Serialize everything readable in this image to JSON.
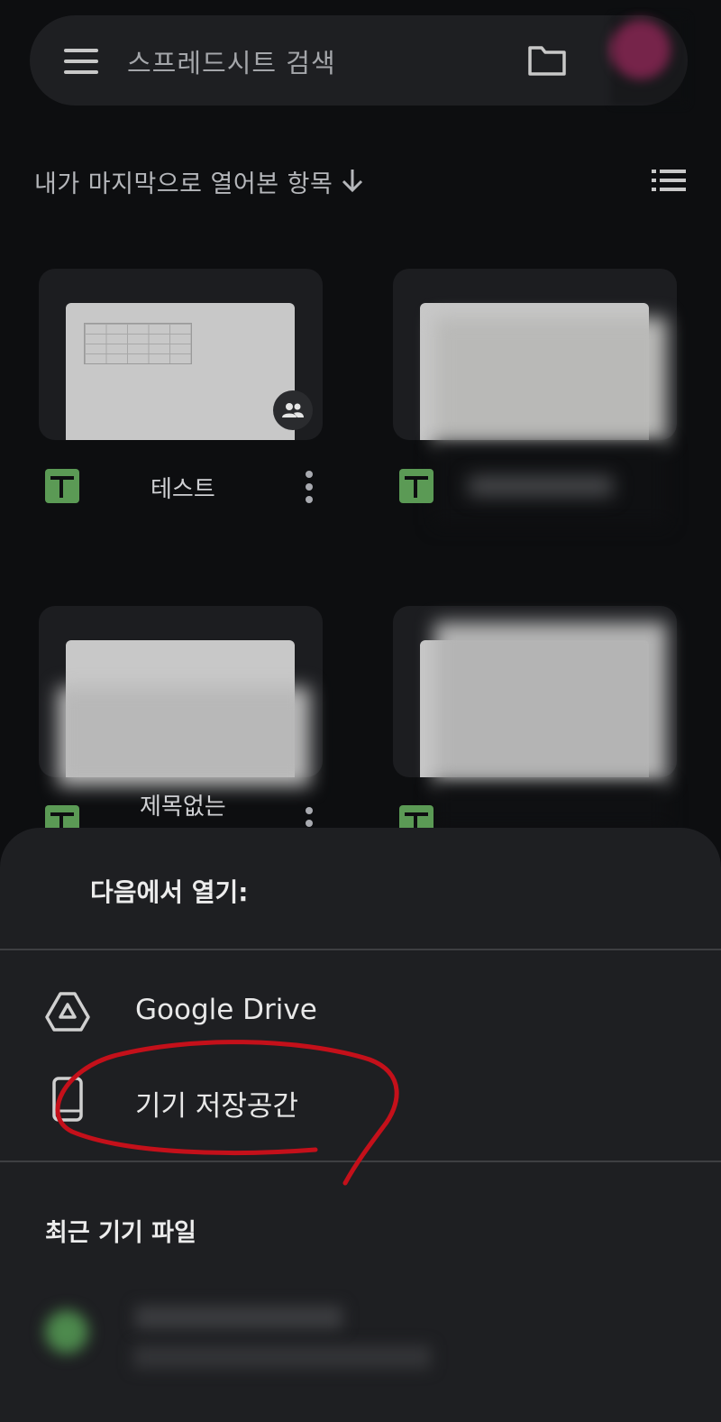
{
  "search": {
    "placeholder": "스프레드시트 검색"
  },
  "sort": {
    "label": "내가 마지막으로 열어본 항목"
  },
  "files": [
    {
      "name": "테스트",
      "shared": true
    },
    {
      "name": "",
      "shared": false
    },
    {
      "name": "제목없는",
      "shared": false
    },
    {
      "name": "",
      "shared": false
    }
  ],
  "sheet": {
    "title": "다음에서 열기:",
    "options": [
      {
        "label": "Google Drive",
        "icon": "google-drive-icon"
      },
      {
        "label": "기기 저장공간",
        "icon": "phone-icon"
      }
    ],
    "recent_title": "최근 기기 파일"
  },
  "colors": {
    "background": "#0d0e10",
    "sheet": "#1e1f22",
    "sheets_green": "#5b9a55",
    "annotation_red": "#c4101a",
    "avatar": "#b0306a"
  }
}
